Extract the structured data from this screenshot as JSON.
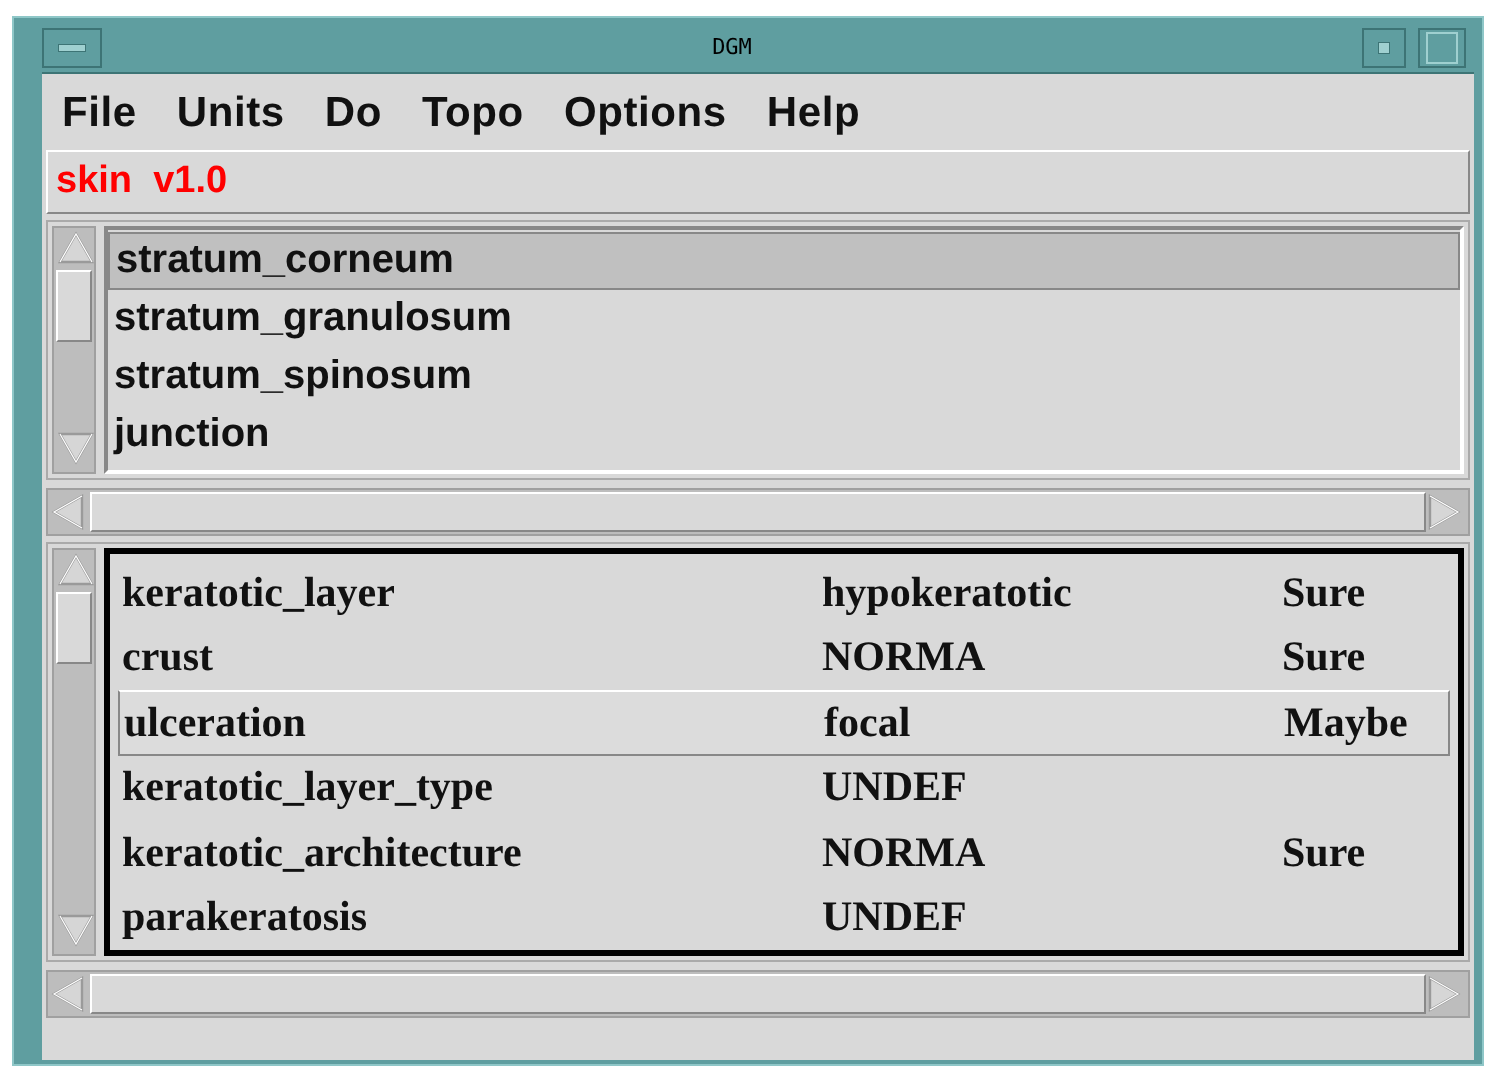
{
  "window": {
    "title": "DGM"
  },
  "menu": [
    {
      "label": "File"
    },
    {
      "label": "Units"
    },
    {
      "label": "Do"
    },
    {
      "label": "Topo"
    },
    {
      "label": "Options"
    },
    {
      "label": "Help"
    }
  ],
  "model_label": "skin  v1.0",
  "layers": [
    {
      "label": "stratum_corneum",
      "selected": true
    },
    {
      "label": "stratum_granulosum",
      "selected": false
    },
    {
      "label": "stratum_spinosum",
      "selected": false
    },
    {
      "label": "junction",
      "selected": false
    }
  ],
  "features": [
    {
      "name": "keratotic_layer",
      "value": "hypokeratotic",
      "certainty": "Sure",
      "selected": false
    },
    {
      "name": "crust",
      "value": "NORMA",
      "certainty": "Sure",
      "selected": false
    },
    {
      "name": "ulceration",
      "value": "focal",
      "certainty": "Maybe",
      "selected": true
    },
    {
      "name": "keratotic_layer_type",
      "value": "UNDEF",
      "selected": false
    },
    {
      "name": "keratotic_architecture",
      "value": "NORMA",
      "certainty": "Sure",
      "selected": false
    },
    {
      "name": "parakeratosis",
      "value": "UNDEF",
      "selected": false
    }
  ]
}
